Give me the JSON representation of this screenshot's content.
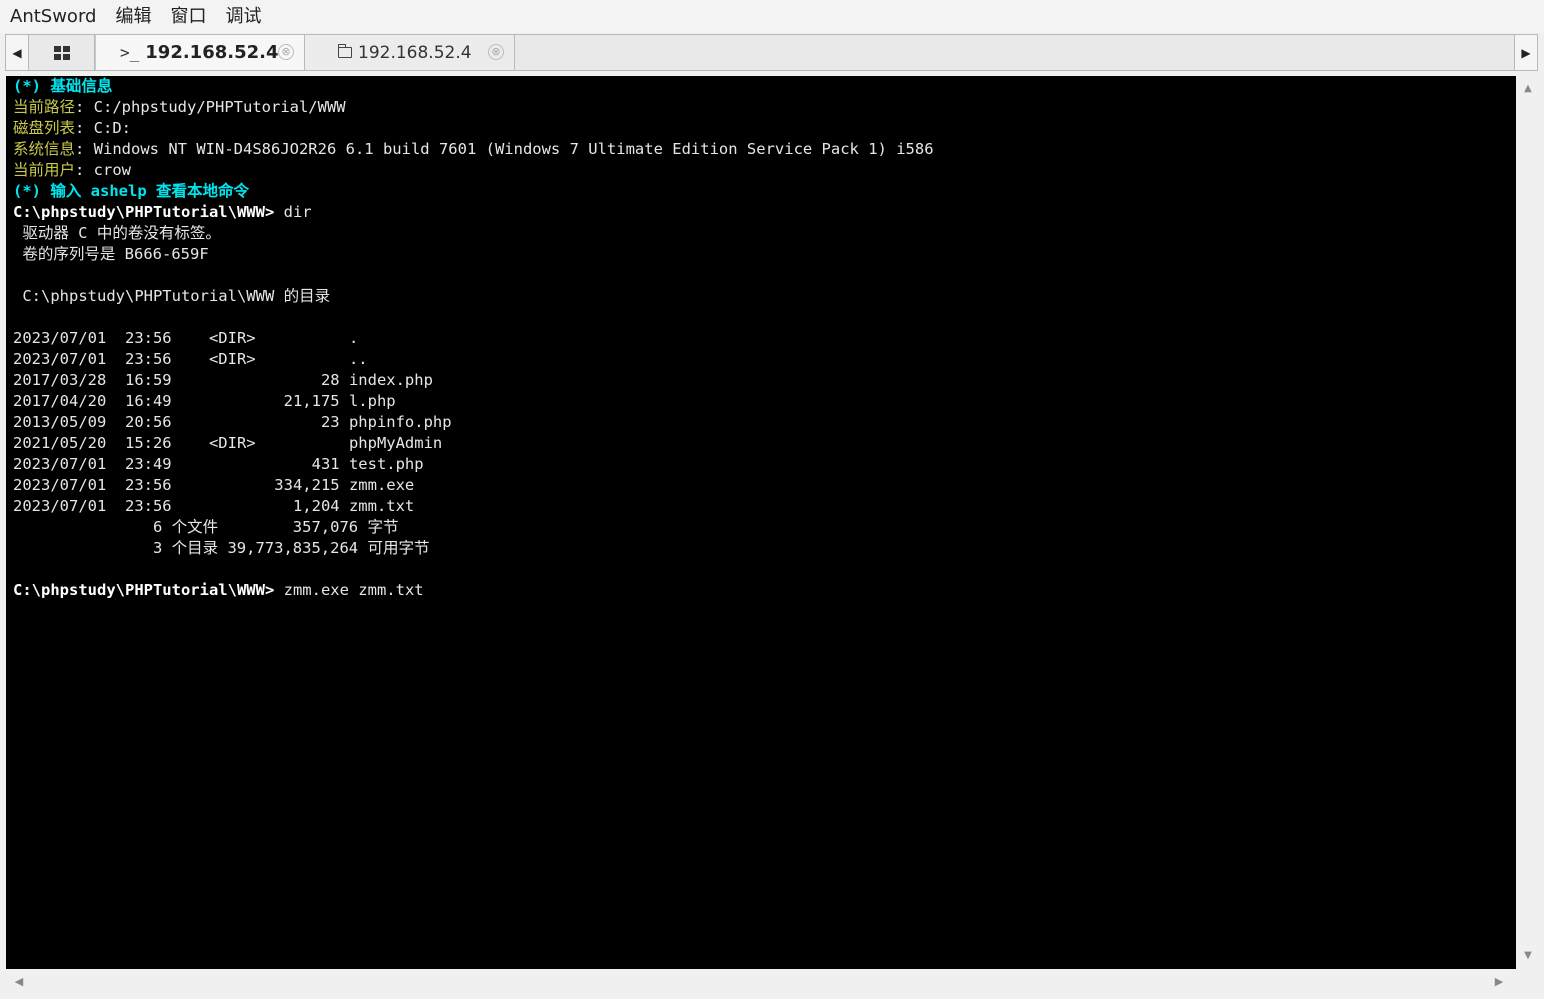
{
  "menu": [
    "AntSword",
    "编辑",
    "窗口",
    "调试"
  ],
  "tabs": {
    "grid_icon": "grid-icon",
    "terminal_tab": {
      "prefix": ">_",
      "label": "192.168.52.4",
      "active": true
    },
    "file_tab": {
      "icon": "folder-icon",
      "label": "192.168.52.4"
    },
    "close_glyph": "⊗"
  },
  "terminal": {
    "lines": [
      {
        "segments": [
          {
            "text": "(*) 基础信息",
            "style": "cyan"
          }
        ]
      },
      {
        "segments": [
          {
            "text": "当前路径",
            "style": "yellow"
          },
          {
            "text": ": C:/phpstudy/PHPTutorial/WWW",
            "style": "plain"
          }
        ]
      },
      {
        "segments": [
          {
            "text": "磁盘列表",
            "style": "yellow"
          },
          {
            "text": ": C:D:",
            "style": "plain"
          }
        ]
      },
      {
        "segments": [
          {
            "text": "系统信息",
            "style": "yellow"
          },
          {
            "text": ": Windows NT WIN-D4S86JO2R26 6.1 build 7601 (Windows 7 Ultimate Edition Service Pack 1) i586",
            "style": "plain"
          }
        ]
      },
      {
        "segments": [
          {
            "text": "当前用户",
            "style": "yellow"
          },
          {
            "text": ": crow",
            "style": "plain"
          }
        ]
      },
      {
        "segments": [
          {
            "text": "(*) 输入 ashelp 查看本地命令",
            "style": "cyan"
          }
        ]
      },
      {
        "segments": [
          {
            "text": "C:\\phpstudy\\PHPTutorial\\WWW> ",
            "style": "bold"
          },
          {
            "text": "dir",
            "style": "plain"
          }
        ]
      },
      {
        "segments": [
          {
            "text": " 驱动器 C 中的卷没有标签。",
            "style": "plain"
          }
        ]
      },
      {
        "segments": [
          {
            "text": " 卷的序列号是 B666-659F",
            "style": "plain"
          }
        ]
      },
      {
        "segments": [
          {
            "text": "",
            "style": "plain"
          }
        ]
      },
      {
        "segments": [
          {
            "text": " C:\\phpstudy\\PHPTutorial\\WWW 的目录",
            "style": "plain"
          }
        ]
      },
      {
        "segments": [
          {
            "text": "",
            "style": "plain"
          }
        ]
      },
      {
        "segments": [
          {
            "text": "2023/07/01  23:56    <DIR>          .",
            "style": "plain"
          }
        ]
      },
      {
        "segments": [
          {
            "text": "2023/07/01  23:56    <DIR>          ..",
            "style": "plain"
          }
        ]
      },
      {
        "segments": [
          {
            "text": "2017/03/28  16:59                28 index.php",
            "style": "plain"
          }
        ]
      },
      {
        "segments": [
          {
            "text": "2017/04/20  16:49            21,175 l.php",
            "style": "plain"
          }
        ]
      },
      {
        "segments": [
          {
            "text": "2013/05/09  20:56                23 phpinfo.php",
            "style": "plain"
          }
        ]
      },
      {
        "segments": [
          {
            "text": "2021/05/20  15:26    <DIR>          phpMyAdmin",
            "style": "plain"
          }
        ]
      },
      {
        "segments": [
          {
            "text": "2023/07/01  23:49               431 test.php",
            "style": "plain"
          }
        ]
      },
      {
        "segments": [
          {
            "text": "2023/07/01  23:56           334,215 zmm.exe",
            "style": "plain"
          }
        ]
      },
      {
        "segments": [
          {
            "text": "2023/07/01  23:56             1,204 zmm.txt",
            "style": "plain"
          }
        ]
      },
      {
        "segments": [
          {
            "text": "               6 个文件        357,076 字节",
            "style": "plain"
          }
        ]
      },
      {
        "segments": [
          {
            "text": "               3 个目录 39,773,835,264 可用字节",
            "style": "plain"
          }
        ]
      },
      {
        "segments": [
          {
            "text": "",
            "style": "plain"
          }
        ]
      },
      {
        "segments": [
          {
            "text": "C:\\phpstudy\\PHPTutorial\\WWW> ",
            "style": "bold"
          },
          {
            "text": "zmm.exe zmm.txt",
            "style": "plain"
          }
        ]
      }
    ]
  },
  "scroll": {
    "up": "▲",
    "down": "▼",
    "left": "◀",
    "right": "▶"
  },
  "colors": {
    "cyan": "#00e5ee",
    "yellow": "#c9c94a",
    "terminal_bg": "#000000",
    "text": "#e6e6e6"
  }
}
